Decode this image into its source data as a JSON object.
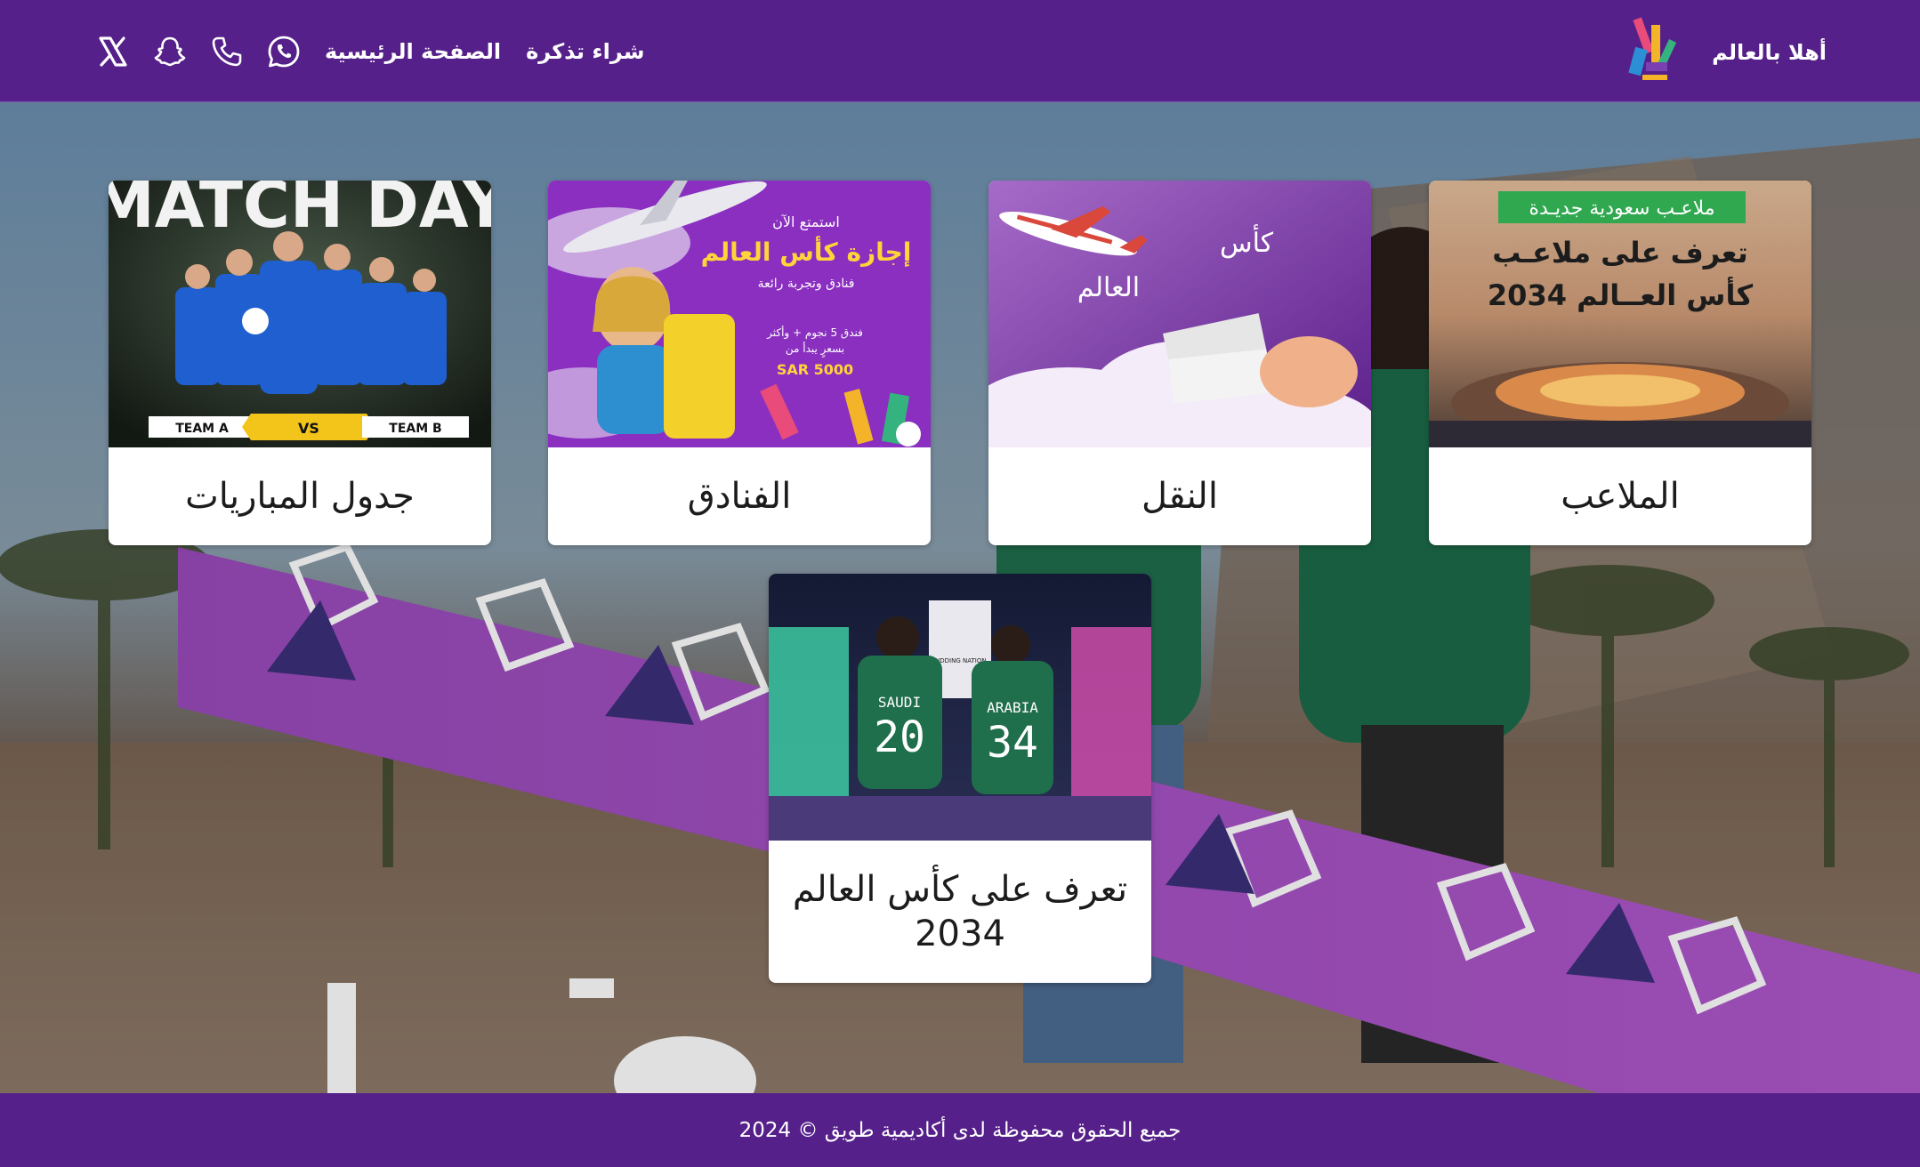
{
  "header": {
    "brand_text": "أهلا بالعالم",
    "nav": [
      {
        "label": "شراء تذكرة"
      },
      {
        "label": "الصفحة الرئيسية"
      }
    ],
    "social_icons": [
      "whatsapp-icon",
      "phone-icon",
      "snapchat-icon",
      "x-icon"
    ]
  },
  "cards": [
    {
      "title": "الملاعب",
      "image": {
        "badge": "ملاعـب سعودية جديـدة",
        "headline_1": "تعرف على ملاعـب",
        "headline_2": "كأس العــالم 2034"
      }
    },
    {
      "title": "النقل",
      "image": {
        "word_1": "كأس",
        "word_2": "العالم"
      }
    },
    {
      "title": "الفنادق",
      "image": {
        "line_1": "استمتع الآن",
        "line_2": "إجازة كأس العالم",
        "line_3": "فنادق وتجربة رائعة",
        "line_4": "فندق 5 نجوم + وأكثر",
        "line_5": "بسعرٍ يبدأ من",
        "price": "5000 SAR"
      }
    },
    {
      "title": "جدول المباريات",
      "image": {
        "banner": "MATCH DAY",
        "team_a": "TEAM A",
        "vs": "VS",
        "team_b": "TEAM B"
      }
    },
    {
      "title": "تعرف على كأس العالم 2034",
      "image": {
        "jersey_left_name": "SAUDI",
        "jersey_left_number": "20",
        "jersey_right_name": "ARABIA",
        "jersey_right_number": "34",
        "screen_text": "BIDDING NATION"
      }
    }
  ],
  "footer": {
    "copyright": "جميع الحقوق محفوظة لدى أكاديمية طويق © 2024"
  },
  "colors": {
    "brand_purple": "#55208a",
    "band_purple": "#a24fc2",
    "band_navy": "#3b2f7a",
    "badge_green": "#2fa84f"
  }
}
